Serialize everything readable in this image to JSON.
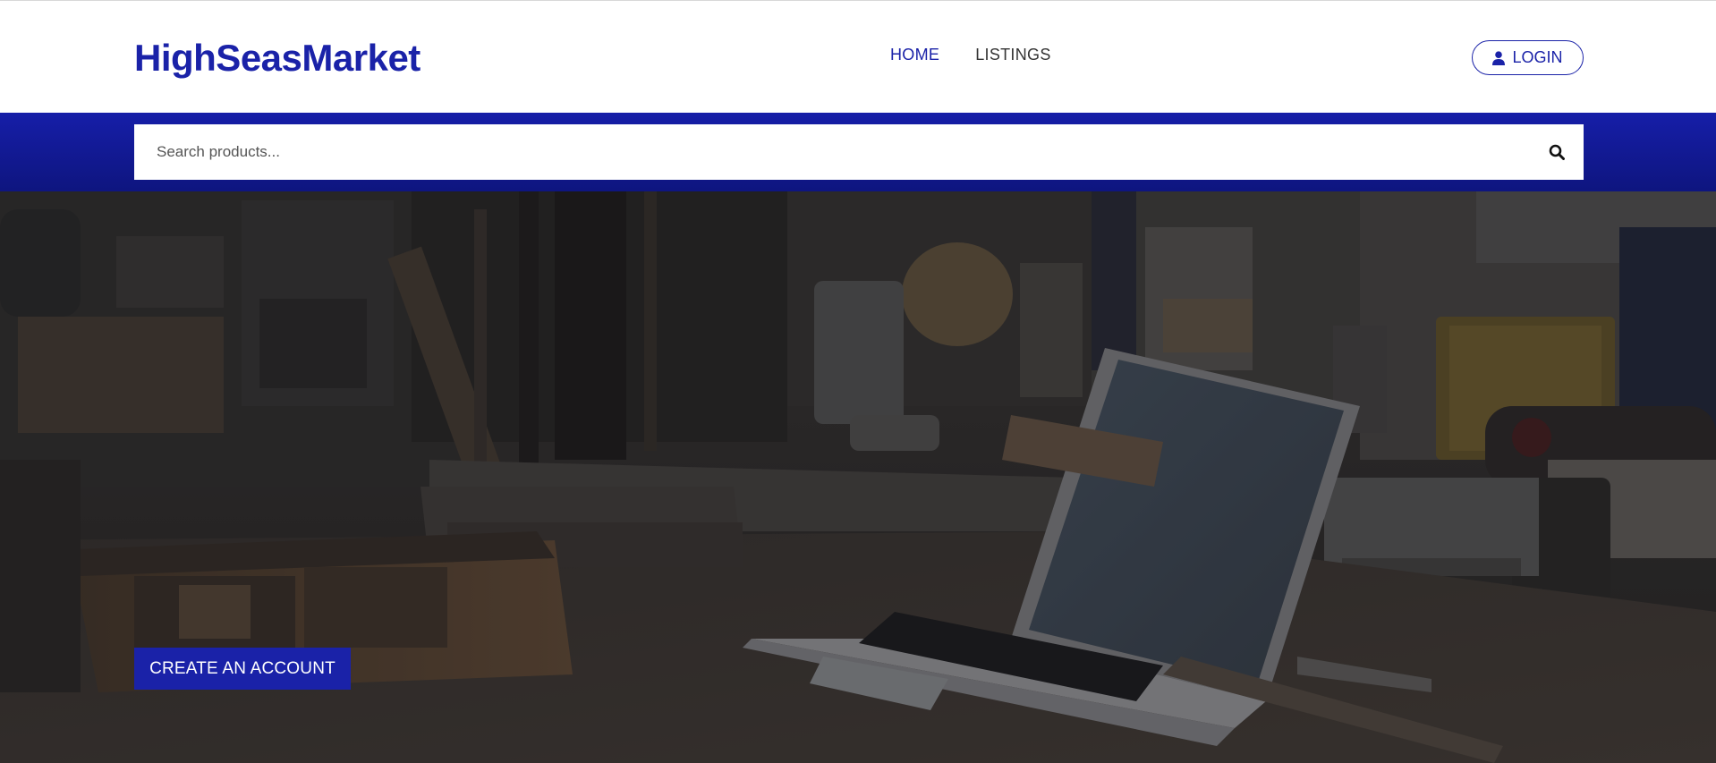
{
  "brand": {
    "name": "HighSeasMarket",
    "color": "#1a22a8"
  },
  "nav": {
    "items": [
      {
        "label": "HOME",
        "active": true
      },
      {
        "label": "LISTINGS",
        "active": false
      }
    ]
  },
  "login": {
    "label": "LOGIN",
    "icon": "user-icon"
  },
  "search": {
    "placeholder": "Search products...",
    "value": "",
    "icon": "search-icon"
  },
  "hero": {
    "image": "workshop-bench-laptop-photo",
    "cta_label": "CREATE AN ACCOUNT"
  },
  "colors": {
    "accent": "#1a22a8",
    "band": "#141c9e"
  }
}
